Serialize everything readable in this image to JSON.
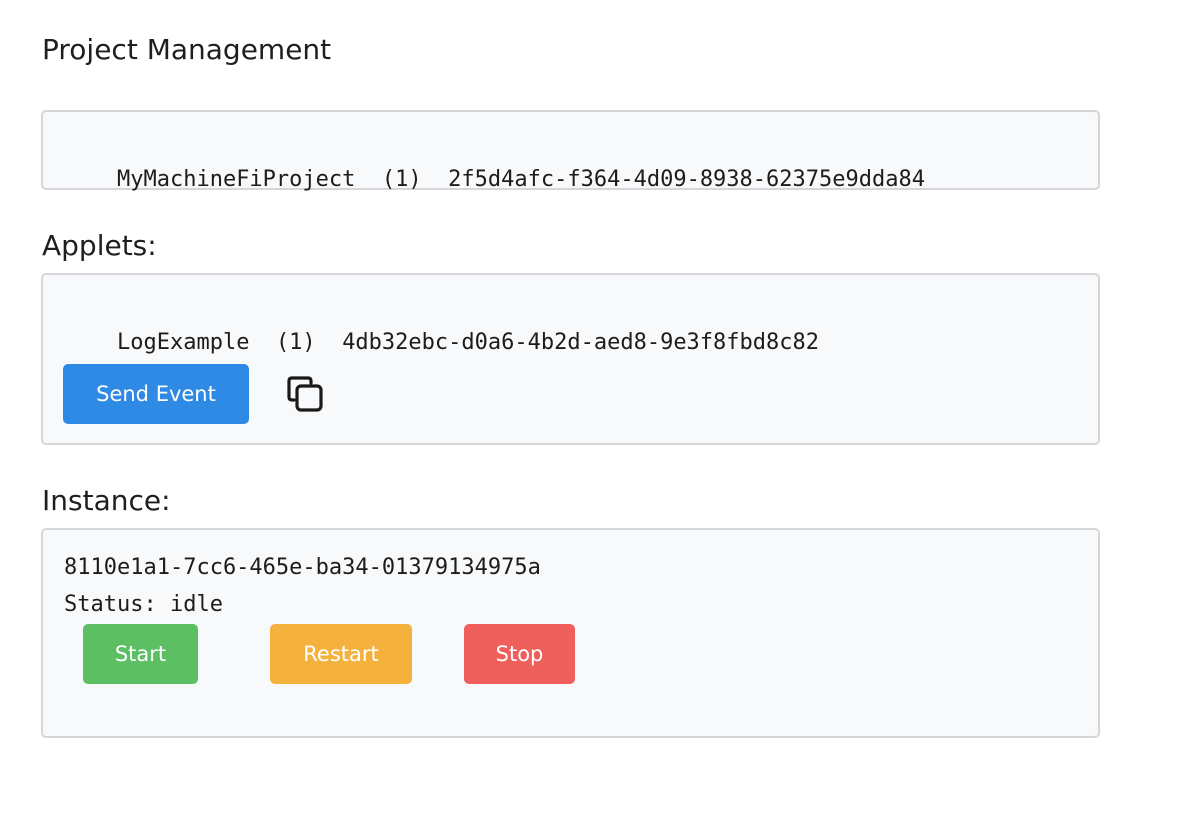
{
  "page": {
    "title": "Project Management"
  },
  "project": {
    "name": "MyMachineFiProject",
    "version": "(1)",
    "id": "2f5d4afc-f364-4d09-8938-62375e9dda84"
  },
  "applets": {
    "label": "Applets:",
    "items": [
      {
        "name": "LogExample",
        "version": "(1)",
        "id": "4db32ebc-d0a6-4b2d-aed8-9e3f8fbd8c82"
      }
    ],
    "send_event_label": "Send Event",
    "copy_icon": "copy-icon"
  },
  "instance": {
    "label": "Instance:",
    "id": "8110e1a1-7cc6-465e-ba34-01379134975a",
    "status_label": "Status:",
    "status_value": "idle",
    "start_label": "Start",
    "restart_label": "Restart",
    "stop_label": "Stop"
  },
  "colors": {
    "send_event": "#2f8ae6",
    "start": "#5cbf63",
    "restart": "#f4b13e",
    "stop": "#ef605c",
    "panel_bg": "#f8f9fa",
    "panel_border": "#d4d6d9"
  }
}
